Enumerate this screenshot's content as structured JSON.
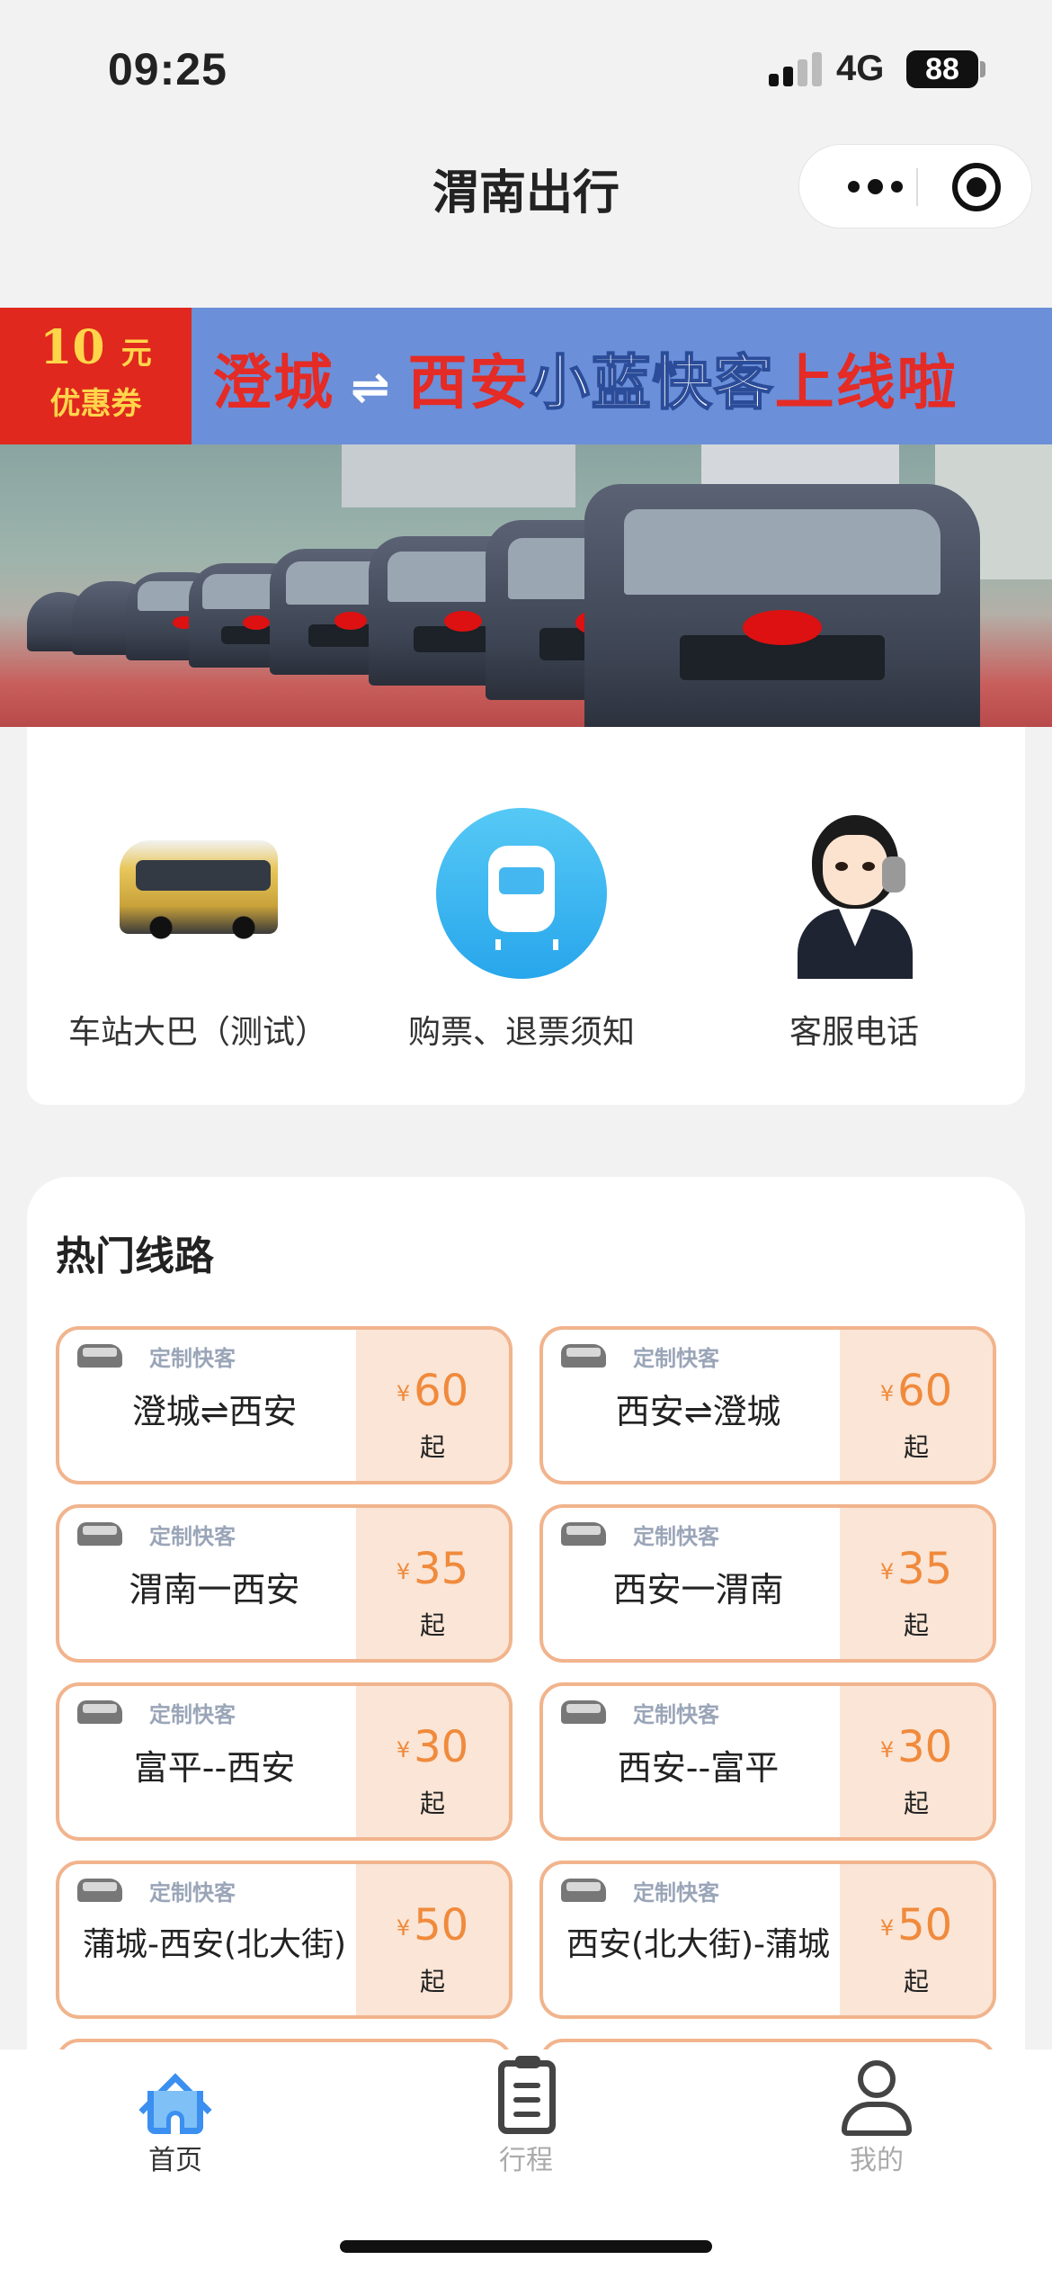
{
  "status_bar": {
    "time": "09:25",
    "network": "4G",
    "battery": "88"
  },
  "nav": {
    "title": "渭南出行",
    "more_icon": "more-dots-icon",
    "close_icon": "target-close-icon"
  },
  "banner": {
    "coupon_amount": "10",
    "coupon_unit": "元",
    "coupon_label": "优惠券",
    "from": "澄城",
    "arrow": "⇌",
    "to": "西安",
    "highlight": "小蓝快客",
    "suffix": "上线啦",
    "indicator": {
      "active_index": 1,
      "count": 2
    }
  },
  "services": [
    {
      "label": "车站大巴（测试）",
      "icon": "bus-icon"
    },
    {
      "label": "购票、退票须知",
      "icon": "train-icon"
    },
    {
      "label": "客服电话",
      "icon": "customer-service-icon"
    }
  ],
  "hot_routes": {
    "title": "热门线路",
    "items": [
      {
        "tag": "定制快客",
        "route": "澄城⇌西安",
        "currency": "¥",
        "price": "60",
        "suffix": "起"
      },
      {
        "tag": "定制快客",
        "route": "西安⇌澄城",
        "currency": "¥",
        "price": "60",
        "suffix": "起"
      },
      {
        "tag": "定制快客",
        "route": "渭南一西安",
        "currency": "¥",
        "price": "35",
        "suffix": "起"
      },
      {
        "tag": "定制快客",
        "route": "西安一渭南",
        "currency": "¥",
        "price": "35",
        "suffix": "起"
      },
      {
        "tag": "定制快客",
        "route": "富平--西安",
        "currency": "¥",
        "price": "30",
        "suffix": "起"
      },
      {
        "tag": "定制快客",
        "route": "西安--富平",
        "currency": "¥",
        "price": "30",
        "suffix": "起"
      },
      {
        "tag": "定制快客",
        "route": "蒲城-西安(北大街)",
        "currency": "¥",
        "price": "50",
        "suffix": "起"
      },
      {
        "tag": "定制快客",
        "route": "西安(北大街)-蒲城",
        "currency": "¥",
        "price": "50",
        "suffix": "起"
      }
    ]
  },
  "tabbar": {
    "active_color": "#333333",
    "inactive_color": "#aaaaaa",
    "tabs": [
      {
        "label": "首页",
        "icon": "home-icon",
        "active": true
      },
      {
        "label": "行程",
        "icon": "trip-clipboard-icon",
        "active": false
      },
      {
        "label": "我的",
        "icon": "user-icon",
        "active": false
      }
    ]
  },
  "colors": {
    "accent_orange": "#f08a3c",
    "card_border": "#f1b48d",
    "price_bg": "#fae5d6",
    "banner_blue": "#6b8fd8",
    "banner_red": "#e0281e"
  }
}
